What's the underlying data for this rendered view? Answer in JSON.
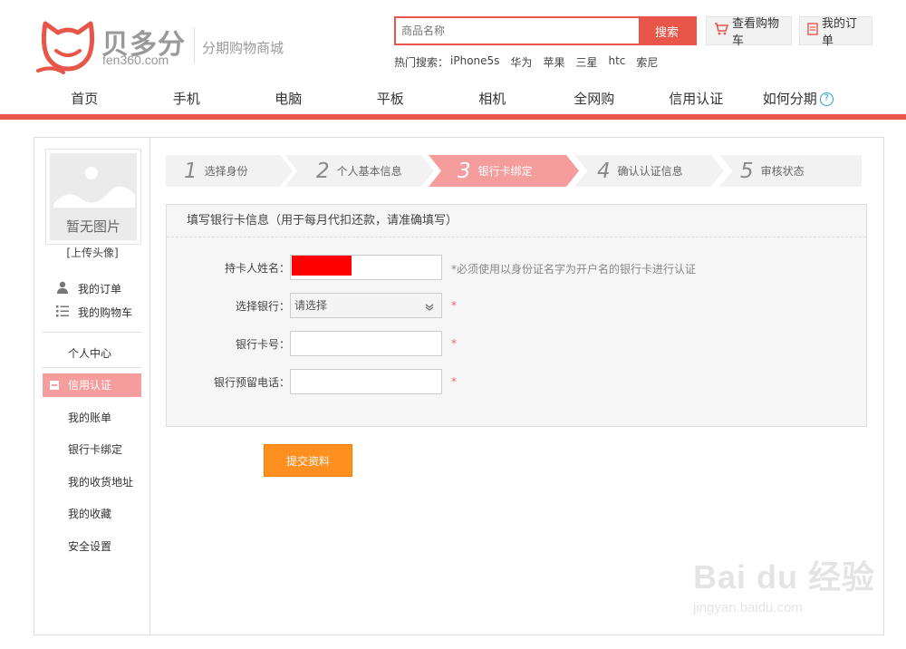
{
  "colors": {
    "brand": "#e8564a",
    "active_step": "#f59c9c",
    "submit": "#ff8f1f",
    "help": "#2a9bd6"
  },
  "header": {
    "brand_cn": "贝多分",
    "brand_url": "fen360.com",
    "slogan": "分期购物商城",
    "search_placeholder": "商品名称",
    "search_button": "搜索",
    "hot_label": "热门搜索：",
    "hot_keywords": [
      "iPhone5s",
      "华为",
      "苹果",
      "三星",
      "htc",
      "索尼"
    ],
    "cart_label": "查看购物车",
    "cart_icon": "cart-icon",
    "order_label": "我的订单",
    "order_icon": "document-icon"
  },
  "nav": [
    "首页",
    "手机",
    "电脑",
    "平板",
    "相机",
    "全网购",
    "信用认证",
    "如何分期"
  ],
  "sidebar": {
    "avatar_text": "暂无图片",
    "upload": "[上传头像]",
    "my_orders": "我的订单",
    "my_cart": "我的购物车",
    "personal_center": "个人中心",
    "active_menu": "信用认证",
    "menu": [
      "我的账单",
      "银行卡绑定",
      "我的收货地址",
      "我的收藏",
      "安全设置"
    ]
  },
  "steps": [
    {
      "num": "1",
      "label": "选择身份"
    },
    {
      "num": "2",
      "label": "个人基本信息"
    },
    {
      "num": "3",
      "label": "银行卡绑定"
    },
    {
      "num": "4",
      "label": "确认认证信息"
    },
    {
      "num": "5",
      "label": "审核状态"
    }
  ],
  "form": {
    "title": "填写银行卡信息（用于每月代扣还款，请准确填写）",
    "cardholder_label": "持卡人姓名：",
    "cardholder_hint": "*必须使用以身份证名字为开户名的银行卡进行认证",
    "bank_label": "选择银行：",
    "bank_value": "请选择",
    "card_label": "银行卡号：",
    "phone_label": "银行预留电话：",
    "required_mark": "*",
    "submit": "提交资料"
  },
  "watermark": {
    "main": "Bai du 经验",
    "sub": "jingyan.baidu.com"
  }
}
